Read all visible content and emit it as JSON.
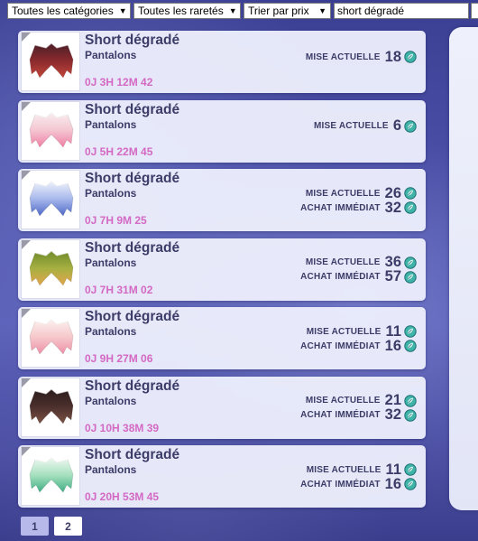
{
  "filters": {
    "category": "Toutes les catégories",
    "rarity": "Toutes les raretés",
    "sort": "Trier par prix",
    "search_value": "short dégradé"
  },
  "labels": {
    "current_bid": "MISE ACTUELLE",
    "buy_now": "ACHAT IMMÉDIAT"
  },
  "items": [
    {
      "name": "Short dégradé",
      "category": "Pantalons",
      "timer": "0J 3H 12M 42",
      "bid": "18",
      "buyout": null,
      "colors": [
        "#4a1f28",
        "#8a2a2e",
        "#c2463b"
      ]
    },
    {
      "name": "Short dégradé",
      "category": "Pantalons",
      "timer": "0J 5H 22M 45",
      "bid": "6",
      "buyout": null,
      "colors": [
        "#f7eef0",
        "#f4c6d2",
        "#ef7fa4"
      ]
    },
    {
      "name": "Short dégradé",
      "category": "Pantalons",
      "timer": "0J 7H 9M 25",
      "bid": "26",
      "buyout": "32",
      "colors": [
        "#eef1fb",
        "#a9b9ec",
        "#4f6ac7"
      ]
    },
    {
      "name": "Short dégradé",
      "category": "Pantalons",
      "timer": "0J 7H 31M 02",
      "bid": "36",
      "buyout": "57",
      "colors": [
        "#6f8a2a",
        "#a6b042",
        "#e4a54c"
      ]
    },
    {
      "name": "Short dégradé",
      "category": "Pantalons",
      "timer": "0J 9H 27M 06",
      "bid": "11",
      "buyout": "16",
      "colors": [
        "#fbf0ee",
        "#f6c9cc",
        "#ee8fa8"
      ]
    },
    {
      "name": "Short dégradé",
      "category": "Pantalons",
      "timer": "0J 10H 38M 39",
      "bid": "21",
      "buyout": "32",
      "colors": [
        "#2b1d1d",
        "#4b2f2c",
        "#7b5244"
      ]
    },
    {
      "name": "Short dégradé",
      "category": "Pantalons",
      "timer": "0J 20H 53M 45",
      "bid": "11",
      "buyout": "16",
      "colors": [
        "#eef8f1",
        "#a7e0bf",
        "#3fae83"
      ]
    }
  ],
  "pagination": {
    "pages": [
      "1",
      "2"
    ],
    "current": "1"
  },
  "coin_icon": "maana-leaf-icon"
}
